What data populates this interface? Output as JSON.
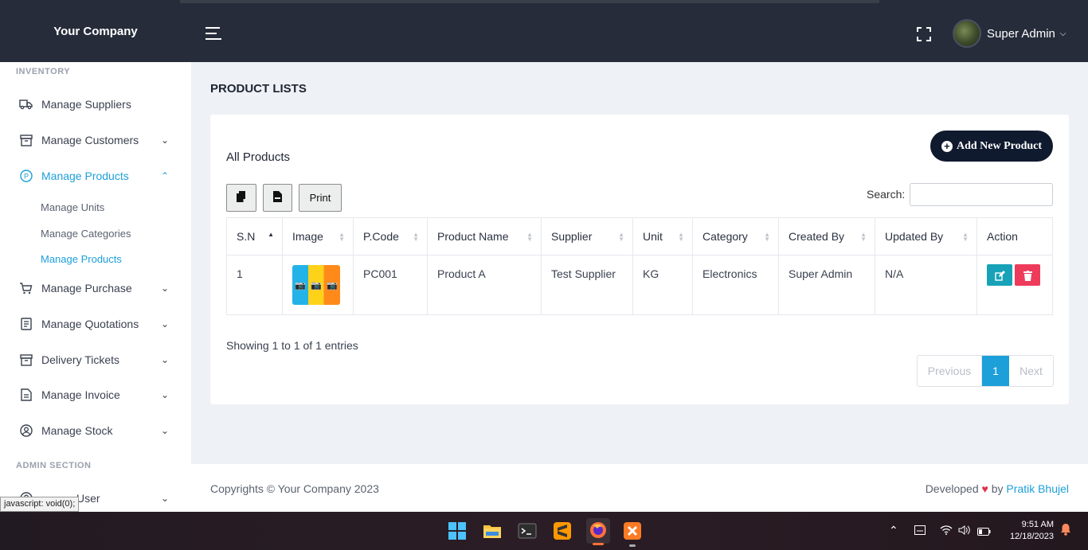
{
  "header": {
    "brand": "Your Company",
    "user_name": "Super Admin",
    "user_caret": "⌄"
  },
  "sidebar": {
    "section_inventory": "INVENTORY",
    "section_admin": "ADMIN SECTION",
    "items": [
      {
        "label": "Manage Suppliers",
        "icon": "truck-icon"
      },
      {
        "label": "Manage Customers",
        "icon": "archive-icon"
      },
      {
        "label": "Manage Products",
        "icon": "product-circle-icon"
      },
      {
        "label": "Manage Purchase",
        "icon": "cart-icon"
      },
      {
        "label": "Manage Quotations",
        "icon": "document-icon"
      },
      {
        "label": "Delivery Tickets",
        "icon": "archive-icon"
      },
      {
        "label": "Manage Invoice",
        "icon": "invoice-icon"
      },
      {
        "label": "Manage Stock",
        "icon": "user-circle-icon"
      },
      {
        "label": "User",
        "icon": "user-circle-icon"
      }
    ],
    "sub_items": [
      "Manage Units",
      "Manage Categories",
      "Manage Products"
    ],
    "status_tooltip": "javascript: void(0);"
  },
  "main": {
    "page_title": "PRODUCT LISTS",
    "card_title": "All Products",
    "add_button": "Add New Product",
    "print_button": "Print",
    "search_label": "Search:",
    "search_value": "",
    "columns": [
      "S.N",
      "Image",
      "P.Code",
      "Product Name",
      "Supplier",
      "Unit",
      "Category",
      "Created By",
      "Updated By",
      "Action"
    ],
    "rows": [
      {
        "sn": "1",
        "code": "PC001",
        "name": "Product A",
        "supplier": "Test Supplier",
        "unit": "KG",
        "category": "Electronics",
        "created_by": "Super Admin",
        "updated_by": "N/A"
      }
    ],
    "info": "Showing 1 to 1 of 1 entries",
    "pager": {
      "previous": "Previous",
      "current": "1",
      "next": "Next"
    }
  },
  "footer": {
    "copyright": "Copyrights © Your Company 2023",
    "developed": "Developed",
    "heart": "♥",
    "by": "by",
    "author": "Pratik Bhujel"
  },
  "taskbar": {
    "time": "9:51 AM",
    "date": "12/18/2023"
  },
  "colors": {
    "accent": "#1d9fd9",
    "header_bg": "#262c3a",
    "add_btn_bg": "#0f1a2e",
    "edit_btn": "#17a2b8",
    "delete_btn": "#ee3b5b"
  }
}
